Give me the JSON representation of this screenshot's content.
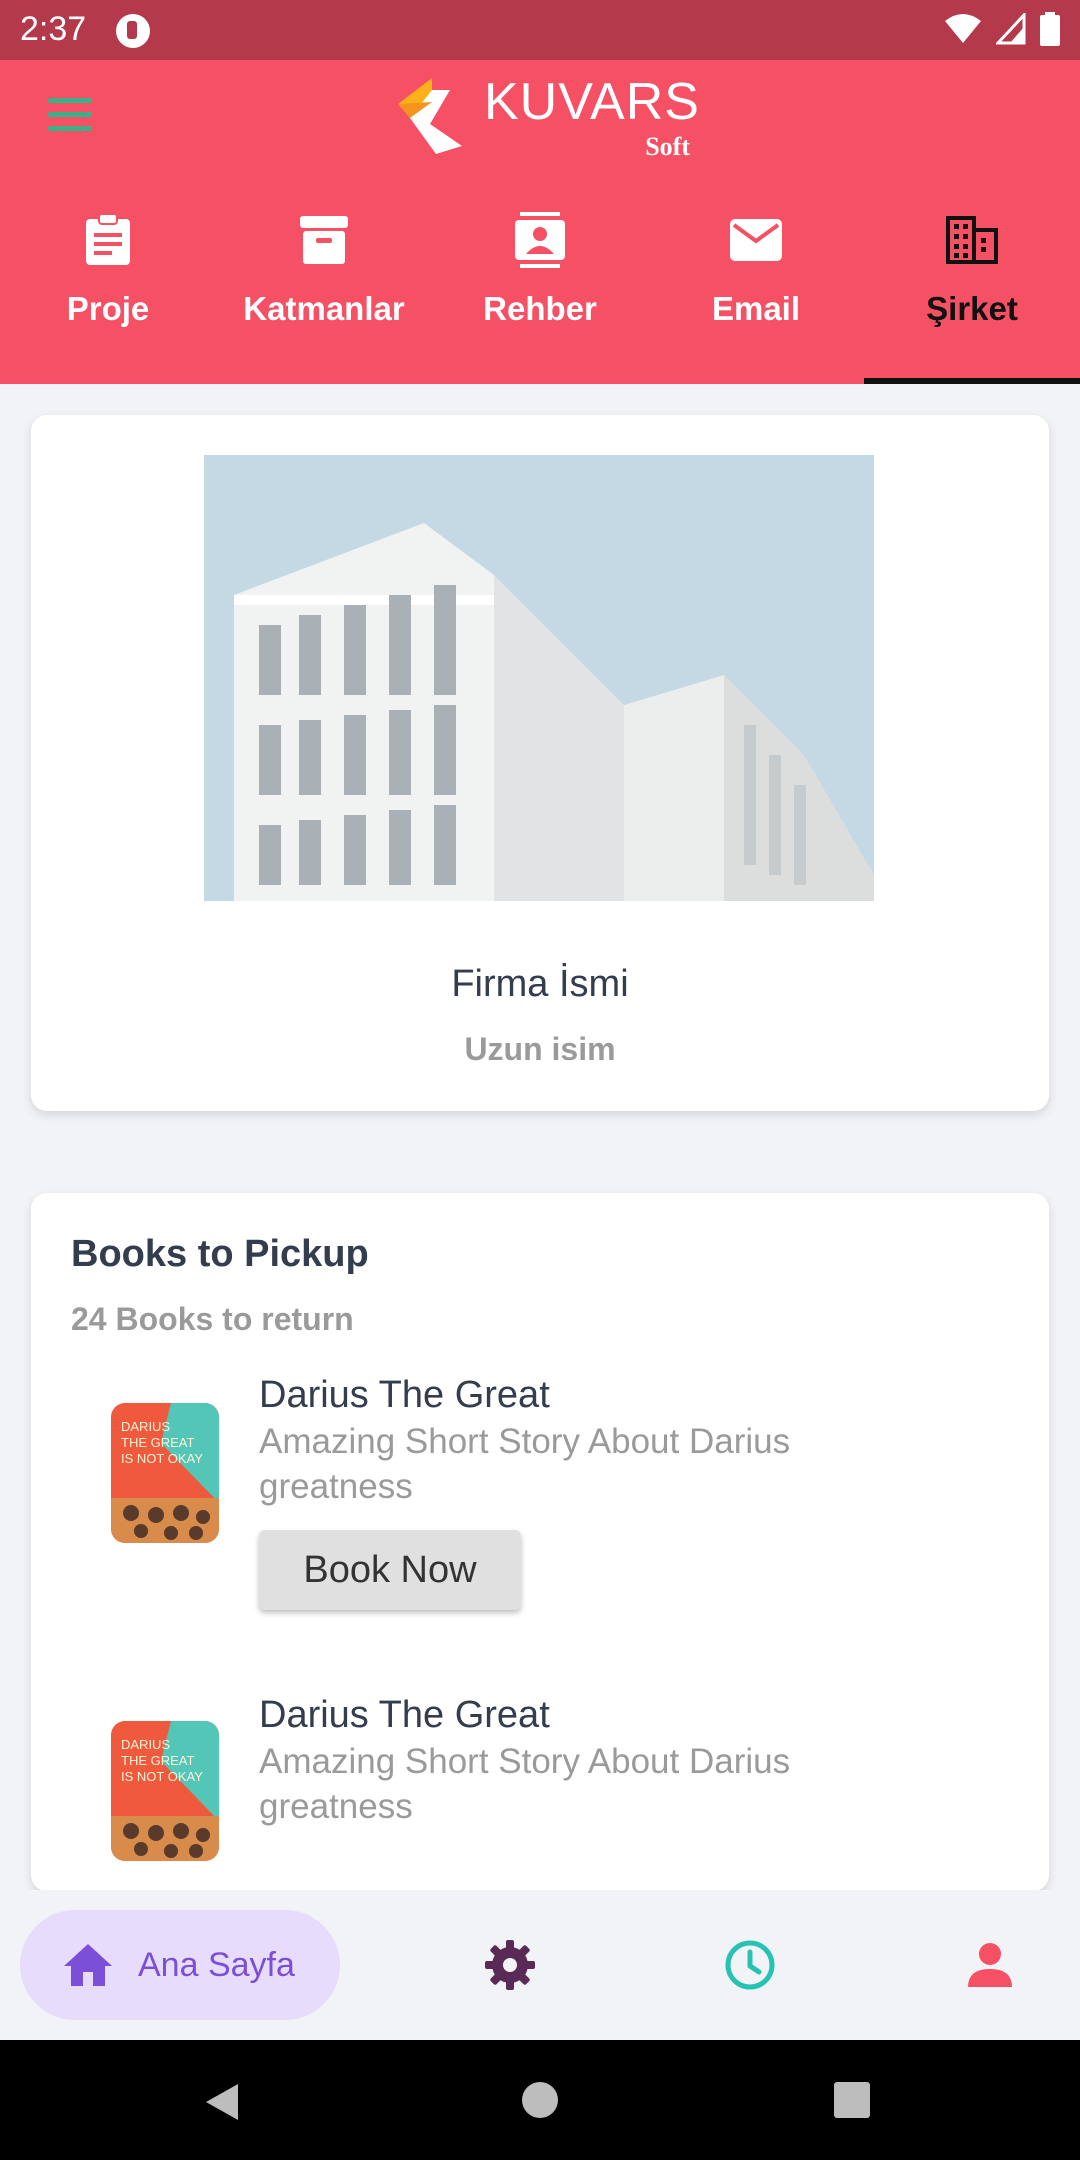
{
  "status_bar": {
    "time": "2:37"
  },
  "header": {
    "logo_text": "KUVARS",
    "logo_sub": "Soft"
  },
  "tabs": [
    {
      "label": "Proje",
      "icon": "clipboard-icon"
    },
    {
      "label": "Katmanlar",
      "icon": "archive-icon"
    },
    {
      "label": "Rehber",
      "icon": "contacts-icon"
    },
    {
      "label": "Email",
      "icon": "mail-icon"
    },
    {
      "label": "Şirket",
      "icon": "business-icon",
      "active": true
    }
  ],
  "company": {
    "name": "Firma İsmi",
    "subtitle": "Uzun isim"
  },
  "books": {
    "title": "Books to Pickup",
    "subtitle": "24 Books to return",
    "items": [
      {
        "title": "Darius The Great",
        "description": "Amazing Short Story About Darius greatness",
        "cover_text": "DARIUS THE GREAT IS NOT OKAY",
        "button": "Book Now"
      },
      {
        "title": "Darius The Great",
        "description": "Amazing Short Story About Darius greatness",
        "cover_text": "DARIUS THE GREAT IS NOT OKAY"
      }
    ]
  },
  "bottom_nav": {
    "home_label": "Ana Sayfa",
    "items": [
      "home-icon",
      "settings-icon",
      "clock-icon",
      "person-icon"
    ]
  },
  "colors": {
    "header": "#f55064",
    "status_bar": "#b3394b",
    "accent_purple": "#7b4fd8",
    "settings": "#5a2a57",
    "clock": "#26c3b5",
    "person": "#f55064"
  }
}
